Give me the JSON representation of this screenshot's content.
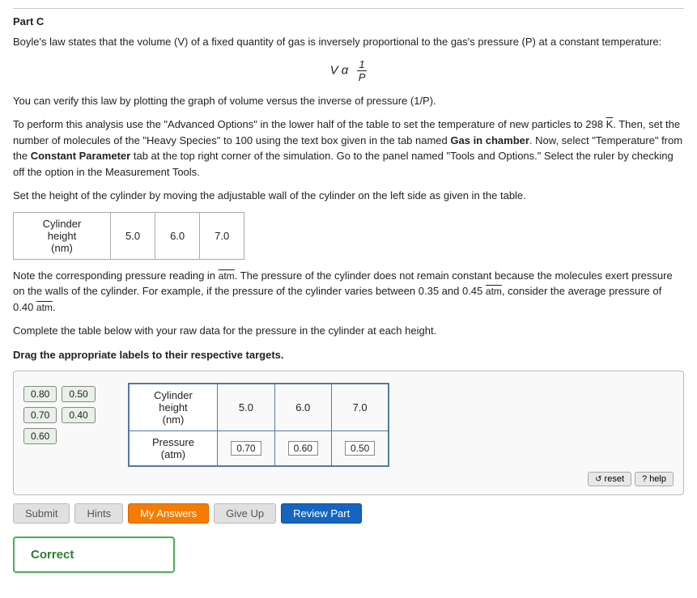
{
  "part": {
    "title": "Part C"
  },
  "paragraphs": {
    "boyles_law": "Boyle's law states that the volume (V) of a fixed quantity of gas is inversely proportional to the gas's pressure (P) at a constant temperature:",
    "verify": "You can verify this law by plotting the graph of volume versus the inverse of pressure (1/P).",
    "instructions": "To perform this analysis use the \"Advanced Options\" in the lower half of the table to set the temperature of new particles to 298 K. Then, set the number of molecules of the \"Heavy Species\" to 100 using the text box given in the tab named Gas in chamber. Now, select \"Temperature\" from the Constant Parameter tab at the top right corner of the simulation. Go to the panel named \"Tools and Options.\" Select the ruler by checking off the option in the Measurement Tools.",
    "set_height": "Set the height of the cylinder by moving the adjustable wall of the cylinder on the left side as given in the table.",
    "note": "Note the corresponding pressure reading in atm. The pressure of the cylinder does not remain constant because the molecules exert pressure on the walls of the cylinder. For example, if the pressure of the cylinder varies between 0.35 and 0.45 atm, consider the average pressure of 0.40 atm.",
    "complete": "Complete the table below with your raw data for the pressure in the cylinder at each height.",
    "drag_label": "Drag the appropriate labels to their respective targets."
  },
  "cylinder_table": {
    "header": "Cylinder height\n(nm)",
    "values": [
      "5.0",
      "6.0",
      "7.0"
    ]
  },
  "drag_section": {
    "labels_left": [
      [
        "0.80",
        "0.50"
      ],
      [
        "0.70",
        "0.40"
      ],
      [
        "0.60"
      ]
    ],
    "table": {
      "rows": [
        {
          "label": "Cylinder height\n(nm)",
          "values": [
            "5.0",
            "6.0",
            "7.0"
          ]
        },
        {
          "label": "Pressure\n(atm)",
          "values": [
            "0.70",
            "0.60",
            "0.50"
          ]
        }
      ]
    },
    "reset_label": "reset",
    "help_label": "? help"
  },
  "buttons": {
    "submit": "Submit",
    "hints": "Hints",
    "my_answers": "My Answers",
    "give_up": "Give Up",
    "review_part": "Review Part"
  },
  "correct": {
    "label": "Correct"
  }
}
